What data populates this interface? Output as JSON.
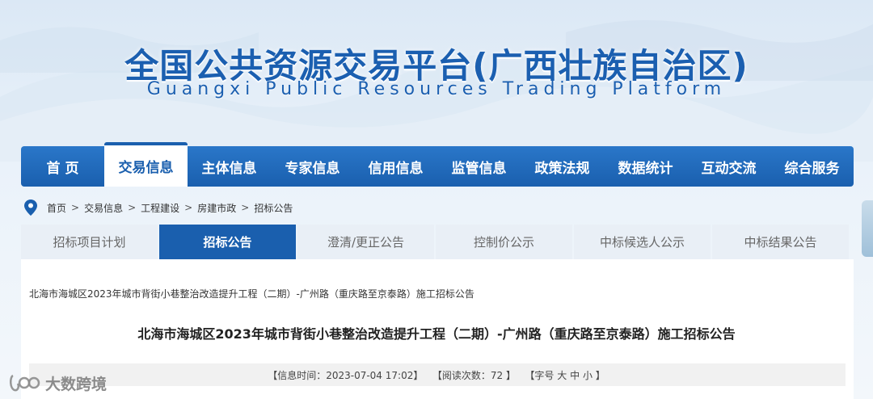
{
  "header": {
    "title_cn": "全国公共资源交易平台(广西壮族自治区)",
    "title_en": "Guangxi Public Resources Trading Platform"
  },
  "nav": {
    "items": [
      {
        "label": "首 页"
      },
      {
        "label": "交易信息",
        "active": true
      },
      {
        "label": "主体信息"
      },
      {
        "label": "专家信息"
      },
      {
        "label": "信用信息"
      },
      {
        "label": "监管信息"
      },
      {
        "label": "政策法规"
      },
      {
        "label": "数据统计"
      },
      {
        "label": "互动交流"
      },
      {
        "label": "综合服务"
      }
    ]
  },
  "breadcrumb": {
    "icon": "location-pin-icon",
    "items": [
      "首页",
      "交易信息",
      "工程建设",
      "房建市政",
      "招标公告"
    ],
    "separator": ">"
  },
  "subtabs": {
    "items": [
      {
        "label": "招标项目计划"
      },
      {
        "label": "招标公告",
        "active": true
      },
      {
        "label": "澄清/更正公告"
      },
      {
        "label": "控制价公示"
      },
      {
        "label": "中标候选人公示"
      },
      {
        "label": "中标结果公告"
      }
    ]
  },
  "content": {
    "small_title": "北海市海城区2023年城市背街小巷整治改造提升工程（二期）-广州路（重庆路至京泰路）施工招标公告",
    "title": "北海市海城区2023年城市背街小巷整治改造提升工程（二期）-广州路（重庆路至京泰路）施工招标公告",
    "meta": {
      "time_label": "【信息时间：",
      "time_value": "2023-07-04 17:02",
      "time_close": "】",
      "views_label": "【阅读次数：",
      "views_value": "72",
      "views_close": "】",
      "font_label": "【字号",
      "font_large": "大",
      "font_medium": "中",
      "font_small": "小",
      "font_close": "】"
    }
  },
  "watermark": {
    "text": "大数跨境"
  },
  "colors": {
    "primary": "#1a5fae",
    "nav_gradient_top": "#2a77c9",
    "subtab_bg": "#e9eff6"
  }
}
